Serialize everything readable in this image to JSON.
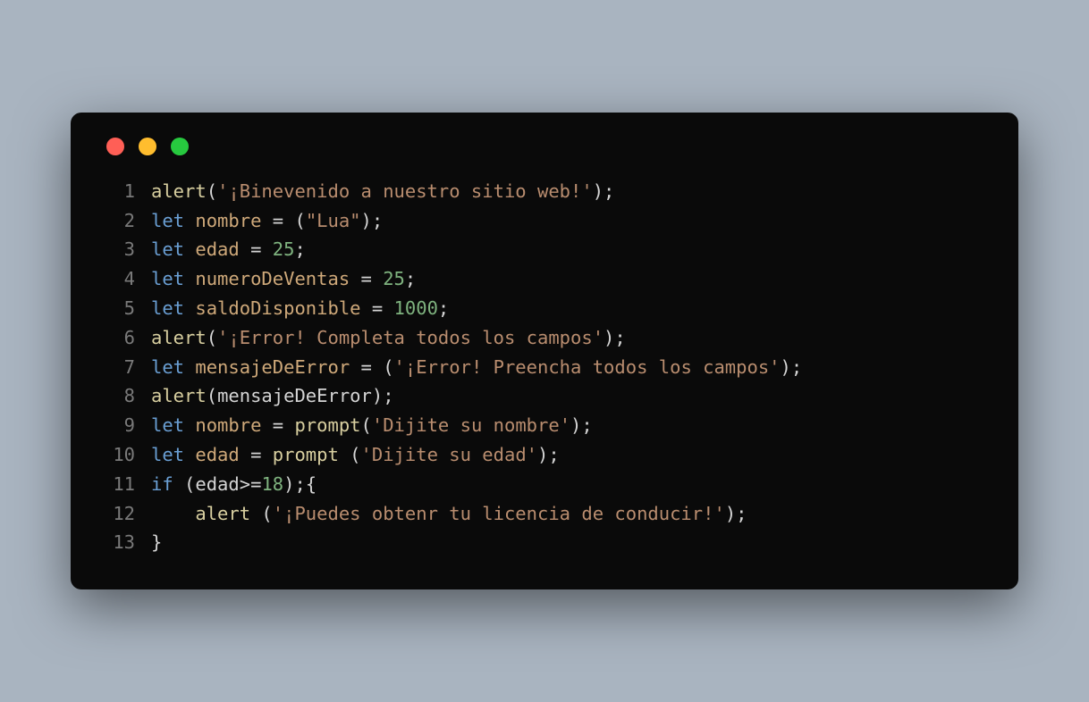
{
  "window": {
    "traffic_lights": [
      "close",
      "minimize",
      "zoom"
    ]
  },
  "code": {
    "lines": [
      {
        "num": "1",
        "tokens": [
          {
            "cls": "tok-fn",
            "t": "alert"
          },
          {
            "cls": "tok-punc",
            "t": "("
          },
          {
            "cls": "tok-str",
            "t": "'¡Binevenido a nuestro sitio web!'"
          },
          {
            "cls": "tok-punc",
            "t": ");"
          }
        ]
      },
      {
        "num": "2",
        "tokens": [
          {
            "cls": "tok-kw",
            "t": "let"
          },
          {
            "cls": "tok-punc",
            "t": " "
          },
          {
            "cls": "tok-var",
            "t": "nombre"
          },
          {
            "cls": "tok-punc",
            "t": " "
          },
          {
            "cls": "tok-op",
            "t": "="
          },
          {
            "cls": "tok-punc",
            "t": " ("
          },
          {
            "cls": "tok-str",
            "t": "\"Lua\""
          },
          {
            "cls": "tok-punc",
            "t": ");"
          }
        ]
      },
      {
        "num": "3",
        "tokens": [
          {
            "cls": "tok-kw",
            "t": "let"
          },
          {
            "cls": "tok-punc",
            "t": " "
          },
          {
            "cls": "tok-var",
            "t": "edad"
          },
          {
            "cls": "tok-punc",
            "t": " "
          },
          {
            "cls": "tok-op",
            "t": "="
          },
          {
            "cls": "tok-punc",
            "t": " "
          },
          {
            "cls": "tok-num",
            "t": "25"
          },
          {
            "cls": "tok-punc",
            "t": ";"
          }
        ]
      },
      {
        "num": "4",
        "tokens": [
          {
            "cls": "tok-kw",
            "t": "let"
          },
          {
            "cls": "tok-punc",
            "t": " "
          },
          {
            "cls": "tok-var",
            "t": "numeroDeVentas"
          },
          {
            "cls": "tok-punc",
            "t": " "
          },
          {
            "cls": "tok-op",
            "t": "="
          },
          {
            "cls": "tok-punc",
            "t": " "
          },
          {
            "cls": "tok-num",
            "t": "25"
          },
          {
            "cls": "tok-punc",
            "t": ";"
          }
        ]
      },
      {
        "num": "5",
        "tokens": [
          {
            "cls": "tok-kw",
            "t": "let"
          },
          {
            "cls": "tok-punc",
            "t": " "
          },
          {
            "cls": "tok-var",
            "t": "saldoDisponible"
          },
          {
            "cls": "tok-punc",
            "t": " "
          },
          {
            "cls": "tok-op",
            "t": "="
          },
          {
            "cls": "tok-punc",
            "t": " "
          },
          {
            "cls": "tok-num",
            "t": "1000"
          },
          {
            "cls": "tok-punc",
            "t": ";"
          }
        ]
      },
      {
        "num": "6",
        "tokens": [
          {
            "cls": "tok-fn",
            "t": "alert"
          },
          {
            "cls": "tok-punc",
            "t": "("
          },
          {
            "cls": "tok-str",
            "t": "'¡Error! Completa todos los campos'"
          },
          {
            "cls": "tok-punc",
            "t": ");"
          }
        ]
      },
      {
        "num": "7",
        "tokens": [
          {
            "cls": "tok-kw",
            "t": "let"
          },
          {
            "cls": "tok-punc",
            "t": " "
          },
          {
            "cls": "tok-var",
            "t": "mensajeDeError"
          },
          {
            "cls": "tok-punc",
            "t": " "
          },
          {
            "cls": "tok-op",
            "t": "="
          },
          {
            "cls": "tok-punc",
            "t": " ("
          },
          {
            "cls": "tok-str",
            "t": "'¡Error! Preencha todos los campos'"
          },
          {
            "cls": "tok-punc",
            "t": ");"
          }
        ]
      },
      {
        "num": "8",
        "tokens": [
          {
            "cls": "tok-fn",
            "t": "alert"
          },
          {
            "cls": "tok-punc",
            "t": "("
          },
          {
            "cls": "tok-id",
            "t": "mensajeDeError"
          },
          {
            "cls": "tok-punc",
            "t": ");"
          }
        ]
      },
      {
        "num": "9",
        "tokens": [
          {
            "cls": "tok-kw",
            "t": "let"
          },
          {
            "cls": "tok-punc",
            "t": " "
          },
          {
            "cls": "tok-var",
            "t": "nombre"
          },
          {
            "cls": "tok-punc",
            "t": " "
          },
          {
            "cls": "tok-op",
            "t": "="
          },
          {
            "cls": "tok-punc",
            "t": " "
          },
          {
            "cls": "tok-fn",
            "t": "prompt"
          },
          {
            "cls": "tok-punc",
            "t": "("
          },
          {
            "cls": "tok-str",
            "t": "'Dijite su nombre'"
          },
          {
            "cls": "tok-punc",
            "t": ");"
          }
        ]
      },
      {
        "num": "10",
        "tokens": [
          {
            "cls": "tok-kw",
            "t": "let"
          },
          {
            "cls": "tok-punc",
            "t": " "
          },
          {
            "cls": "tok-var",
            "t": "edad"
          },
          {
            "cls": "tok-punc",
            "t": " "
          },
          {
            "cls": "tok-op",
            "t": "="
          },
          {
            "cls": "tok-punc",
            "t": " "
          },
          {
            "cls": "tok-fn",
            "t": "prompt"
          },
          {
            "cls": "tok-punc",
            "t": " ("
          },
          {
            "cls": "tok-str",
            "t": "'Dijite su edad'"
          },
          {
            "cls": "tok-punc",
            "t": ");"
          }
        ]
      },
      {
        "num": "11",
        "tokens": [
          {
            "cls": "tok-kw",
            "t": "if"
          },
          {
            "cls": "tok-punc",
            "t": " ("
          },
          {
            "cls": "tok-id",
            "t": "edad"
          },
          {
            "cls": "tok-op",
            "t": ">="
          },
          {
            "cls": "tok-num",
            "t": "18"
          },
          {
            "cls": "tok-punc",
            "t": ");{"
          }
        ]
      },
      {
        "num": "12",
        "tokens": [
          {
            "cls": "tok-punc",
            "t": "    "
          },
          {
            "cls": "tok-fn",
            "t": "alert"
          },
          {
            "cls": "tok-punc",
            "t": " ("
          },
          {
            "cls": "tok-str",
            "t": "'¡Puedes obtenr tu licencia de conducir!'"
          },
          {
            "cls": "tok-punc",
            "t": ");"
          }
        ]
      },
      {
        "num": "13",
        "tokens": [
          {
            "cls": "tok-punc",
            "t": "}"
          }
        ]
      }
    ]
  }
}
